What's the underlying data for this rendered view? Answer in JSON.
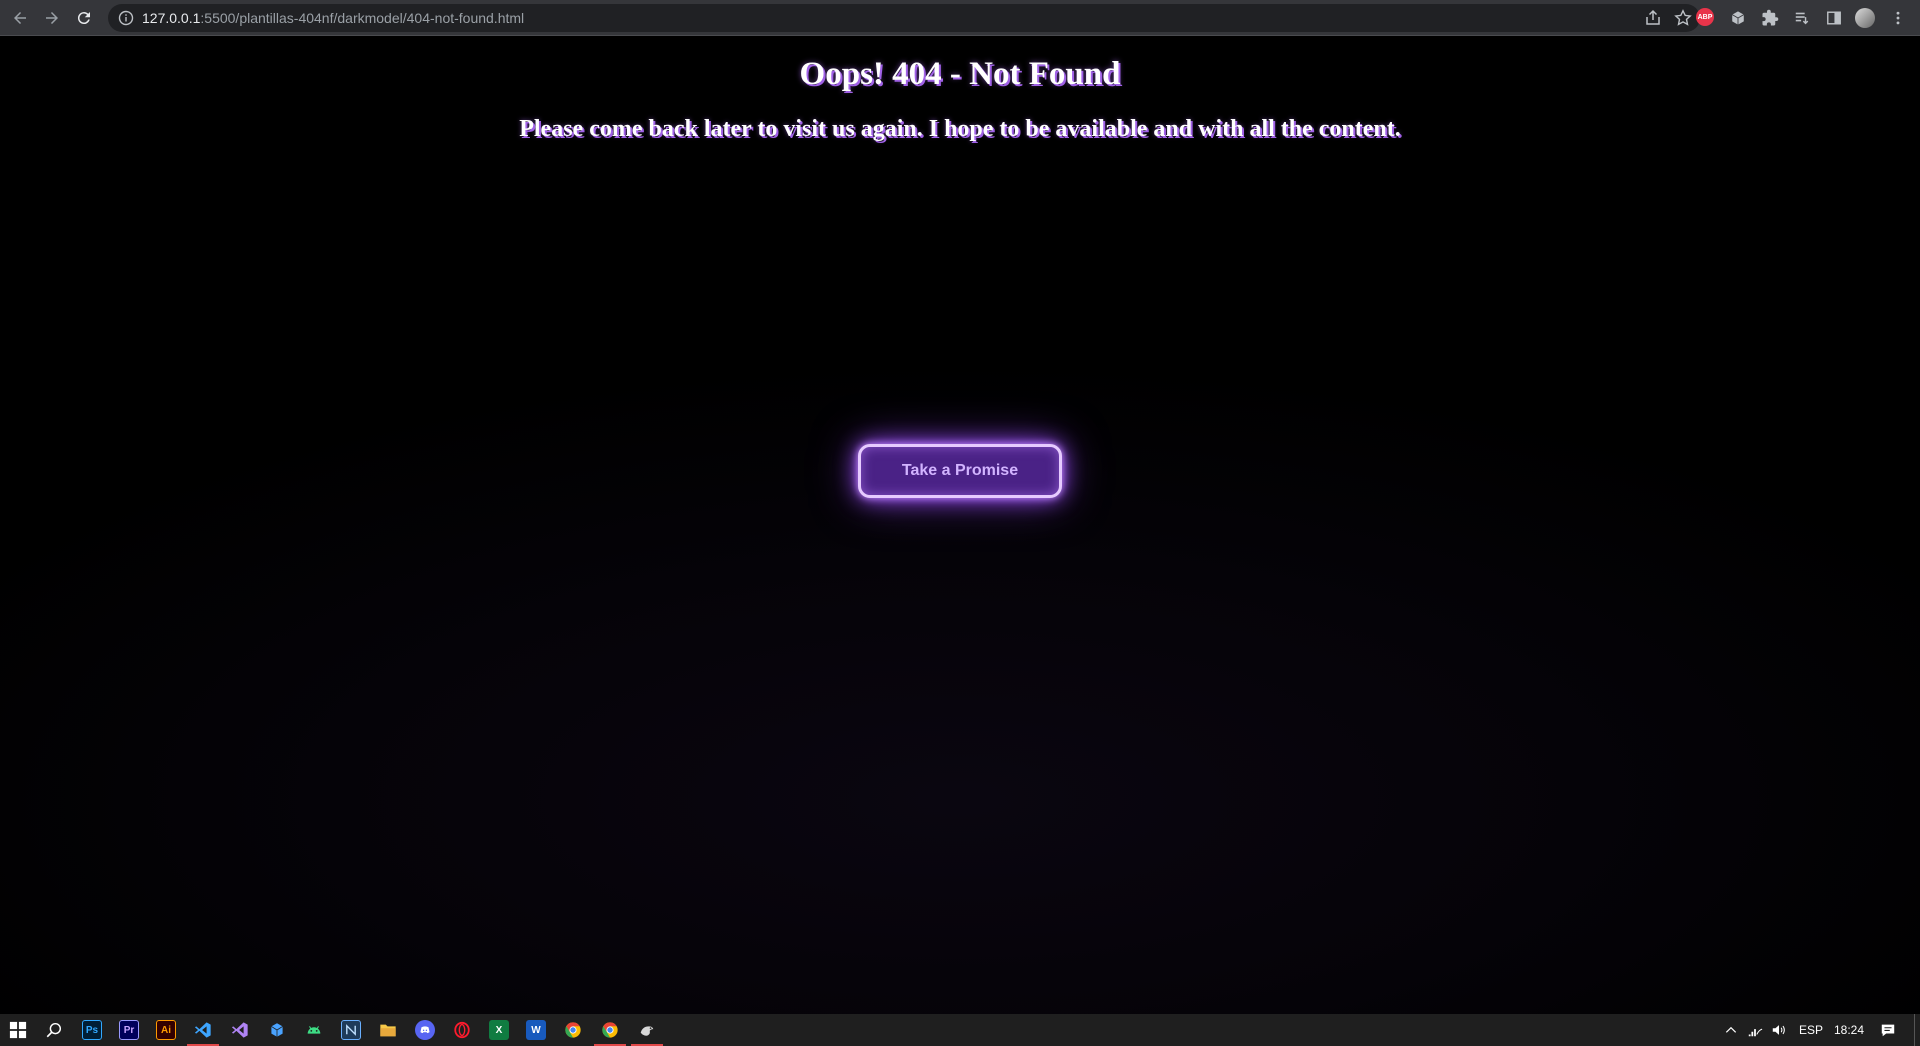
{
  "browser": {
    "url_host": "127.0.0.1",
    "url_rest": ":5500/plantillas-404nf/darkmodel/404-not-found.html",
    "extensions": [
      {
        "name": "adblock-plus-icon",
        "label": "ABP"
      },
      {
        "name": "cube-extension-icon"
      },
      {
        "name": "puzzle-extensions-icon"
      },
      {
        "name": "reading-list-icon"
      },
      {
        "name": "side-panel-icon"
      },
      {
        "name": "profile-avatar"
      },
      {
        "name": "menu-kebab-icon"
      }
    ]
  },
  "page": {
    "title": "Oops! 404 - Not Found",
    "subtitle": "Please come back later to visit us again. I hope to be available and with all the content.",
    "button_label": "Take a Promise",
    "colors": {
      "background": "#000000",
      "text_shadow": "#a061e6",
      "button_fill": "#4a2286",
      "button_border": "#e6cbff",
      "button_glow": "#9b4dff",
      "button_text": "#d2b4ff"
    }
  },
  "taskbar": {
    "apps": [
      {
        "name": "windows-start-icon",
        "label": ""
      },
      {
        "name": "search-icon",
        "label": ""
      },
      {
        "name": "photoshop-icon",
        "label": "Ps"
      },
      {
        "name": "premiere-icon",
        "label": "Pr"
      },
      {
        "name": "illustrator-icon",
        "label": "Ai"
      },
      {
        "name": "vscode-icon",
        "label": ""
      },
      {
        "name": "visual-studio-icon",
        "label": ""
      },
      {
        "name": "app-cube-icon",
        "label": ""
      },
      {
        "name": "android-studio-icon",
        "label": ""
      },
      {
        "name": "app-n-icon",
        "label": ""
      },
      {
        "name": "file-explorer-icon",
        "label": ""
      },
      {
        "name": "discord-icon",
        "label": ""
      },
      {
        "name": "opera-icon",
        "label": ""
      },
      {
        "name": "excel-icon",
        "label": "X"
      },
      {
        "name": "word-icon",
        "label": "W"
      },
      {
        "name": "chrome-icon",
        "label": ""
      },
      {
        "name": "chrome-active-icon",
        "label": ""
      },
      {
        "name": "app-bird-icon",
        "label": ""
      }
    ],
    "language": "ESP",
    "time": "18:24"
  }
}
